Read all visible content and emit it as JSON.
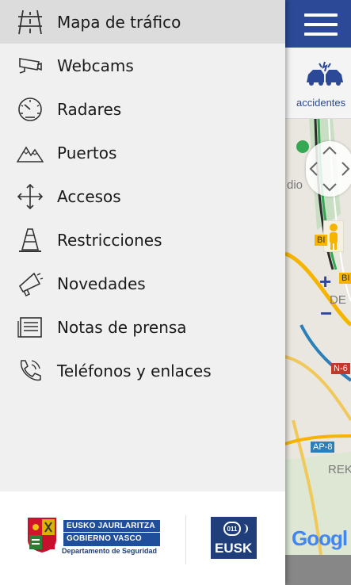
{
  "menu": {
    "items": [
      {
        "label": "Mapa de tráfico",
        "icon": "highway-icon",
        "active": true
      },
      {
        "label": "Webcams",
        "icon": "camera-icon",
        "active": false
      },
      {
        "label": "Radares",
        "icon": "speedometer-icon",
        "active": false
      },
      {
        "label": "Puertos",
        "icon": "mountain-icon",
        "active": false
      },
      {
        "label": "Accesos",
        "icon": "arrows-cross-icon",
        "active": false
      },
      {
        "label": "Restricciones",
        "icon": "traffic-cone-icon",
        "active": false
      },
      {
        "label": "Novedades",
        "icon": "megaphone-icon",
        "active": false
      },
      {
        "label": "Notas de prensa",
        "icon": "newspaper-icon",
        "active": false
      },
      {
        "label": "Teléfonos y enlaces",
        "icon": "phone-icon",
        "active": false
      }
    ]
  },
  "footer": {
    "gov_logo": {
      "line1": "EUSKO JAURLARITZA",
      "line2": "GOBIERNO VASCO",
      "line3": "Departamento de Seguridad"
    },
    "eusk_logo": {
      "number": "011",
      "text": "EUSK"
    }
  },
  "right_panel": {
    "category_label": "accidentes",
    "map_labels": [
      "dio",
      "DE",
      "REK"
    ],
    "road_labels": [
      "BI",
      "BI",
      "N-6",
      "AP-8"
    ],
    "zoom_in": "+",
    "zoom_out": "−",
    "google_text": "Googl"
  },
  "colors": {
    "header_blue": "#2b4996",
    "drawer_bg": "#f0f0f0",
    "active_item_bg": "#dcdcdc"
  }
}
